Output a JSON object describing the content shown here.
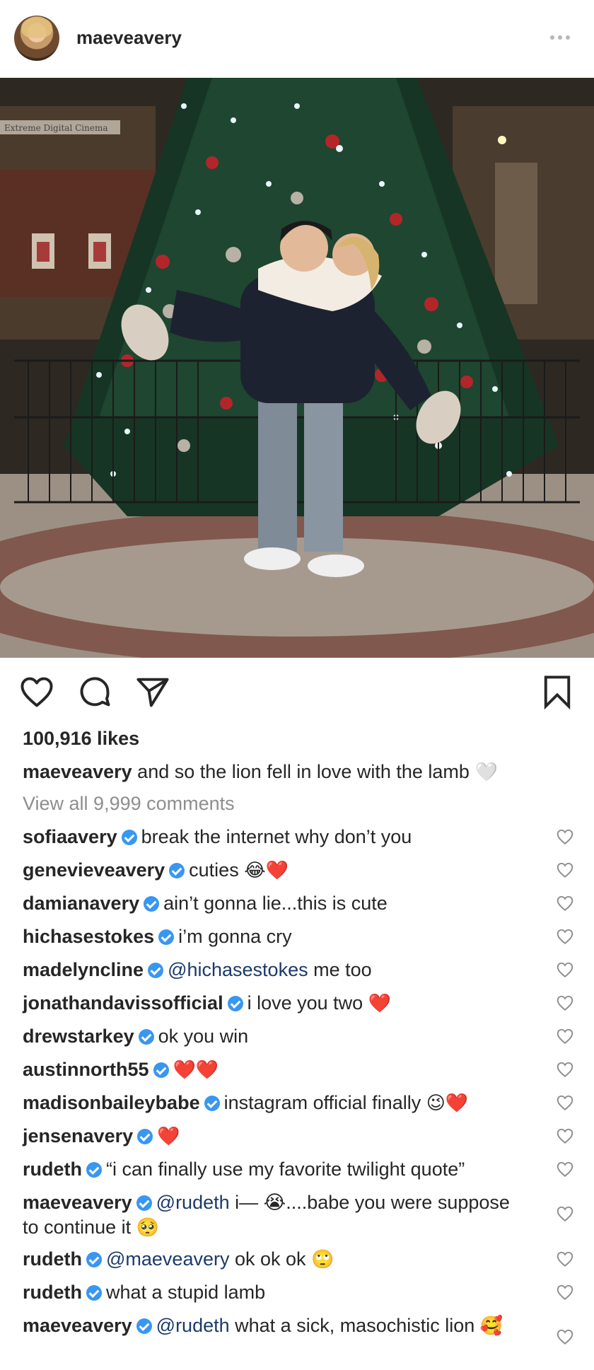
{
  "header": {
    "username": "maeveavery",
    "more_icon": "more-horizontal-icon"
  },
  "photo": {
    "sign_text": "Extreme Digital Cinema"
  },
  "actions": {
    "like_icon": "heart-outline-icon",
    "comment_icon": "comment-bubble-icon",
    "share_icon": "paper-plane-icon",
    "save_icon": "bookmark-icon"
  },
  "post": {
    "likes": "100,916 likes",
    "caption_user": "maeveavery",
    "caption_text": "and so the lion fell in love with the lamb",
    "caption_emoji": "🤍",
    "view_all": "View all 9,999 comments"
  },
  "comments": [
    {
      "user": "sofiaavery",
      "text": "break the internet why don’t you"
    },
    {
      "user": "genevieveavery",
      "text": "cuties",
      "emoji": "😂❤️"
    },
    {
      "user": "damianavery",
      "text": "ain’t gonna lie...this is cute"
    },
    {
      "user": "hichasestokes",
      "text": "i’m gonna cry"
    },
    {
      "user": "madelyncline",
      "mention": "@hichasestokes",
      "text": "me too"
    },
    {
      "user": "jonathandavissofficial",
      "text": "i love you two",
      "emoji": "❤️"
    },
    {
      "user": "drewstarkey",
      "text": "ok you win"
    },
    {
      "user": "austinnorth55",
      "text": "",
      "emoji": "❤️❤️"
    },
    {
      "user": "madisonbaileybabe",
      "text": "instagram official finally",
      "emoji": "😉❤️"
    },
    {
      "user": "jensenavery",
      "text": "",
      "emoji": "❤️"
    },
    {
      "user": "rudeth",
      "text": "“i can finally use my favorite twilight quote”"
    },
    {
      "user": "maeveavery",
      "mention": "@rudeth",
      "text": "i— 😭....babe you were suppose to continue it",
      "emoji": "🥺"
    },
    {
      "user": "rudeth",
      "mention": "@maeveavery",
      "text": "ok ok ok",
      "emoji": "🙄"
    },
    {
      "user": "rudeth",
      "text": "what a stupid lamb"
    },
    {
      "user": "maeveavery",
      "mention": "@rudeth",
      "text": "what a sick, masochistic lion",
      "emoji": "🥰"
    }
  ],
  "colors": {
    "verified": "#3897f0",
    "mention": "#1c3a6a",
    "muted": "#8e8e8e",
    "text": "#262626"
  }
}
